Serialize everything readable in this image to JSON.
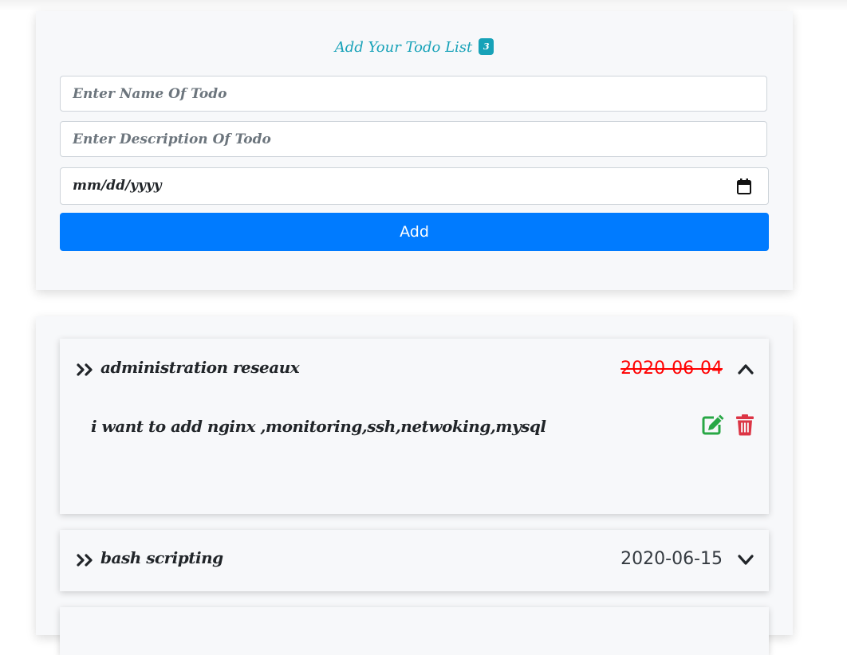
{
  "form": {
    "title": "Add Your Todo List",
    "count": "3",
    "name_placeholder": "Enter Name Of Todo",
    "description_placeholder": "Enter Description Of Todo",
    "date_placeholder": "mm/dd/yyyy",
    "add_label": "Add",
    "accent_color": "#17a2b8",
    "button_color": "#007bff"
  },
  "todos": [
    {
      "name": "administration reseaux",
      "date": "2020-06-04",
      "date_struck": true,
      "expanded": true,
      "description": "i want to add nginx ,monitoring,ssh,netwoking,mysql",
      "toggle_icon": "chevron-up-icon"
    },
    {
      "name": "bash scripting",
      "date": "2020-06-15",
      "date_struck": false,
      "expanded": false,
      "toggle_icon": "chevron-down-icon"
    }
  ],
  "colors": {
    "overdue_date": "#ff0000",
    "edit_icon": "#28a745",
    "delete_icon": "#dc3545"
  }
}
